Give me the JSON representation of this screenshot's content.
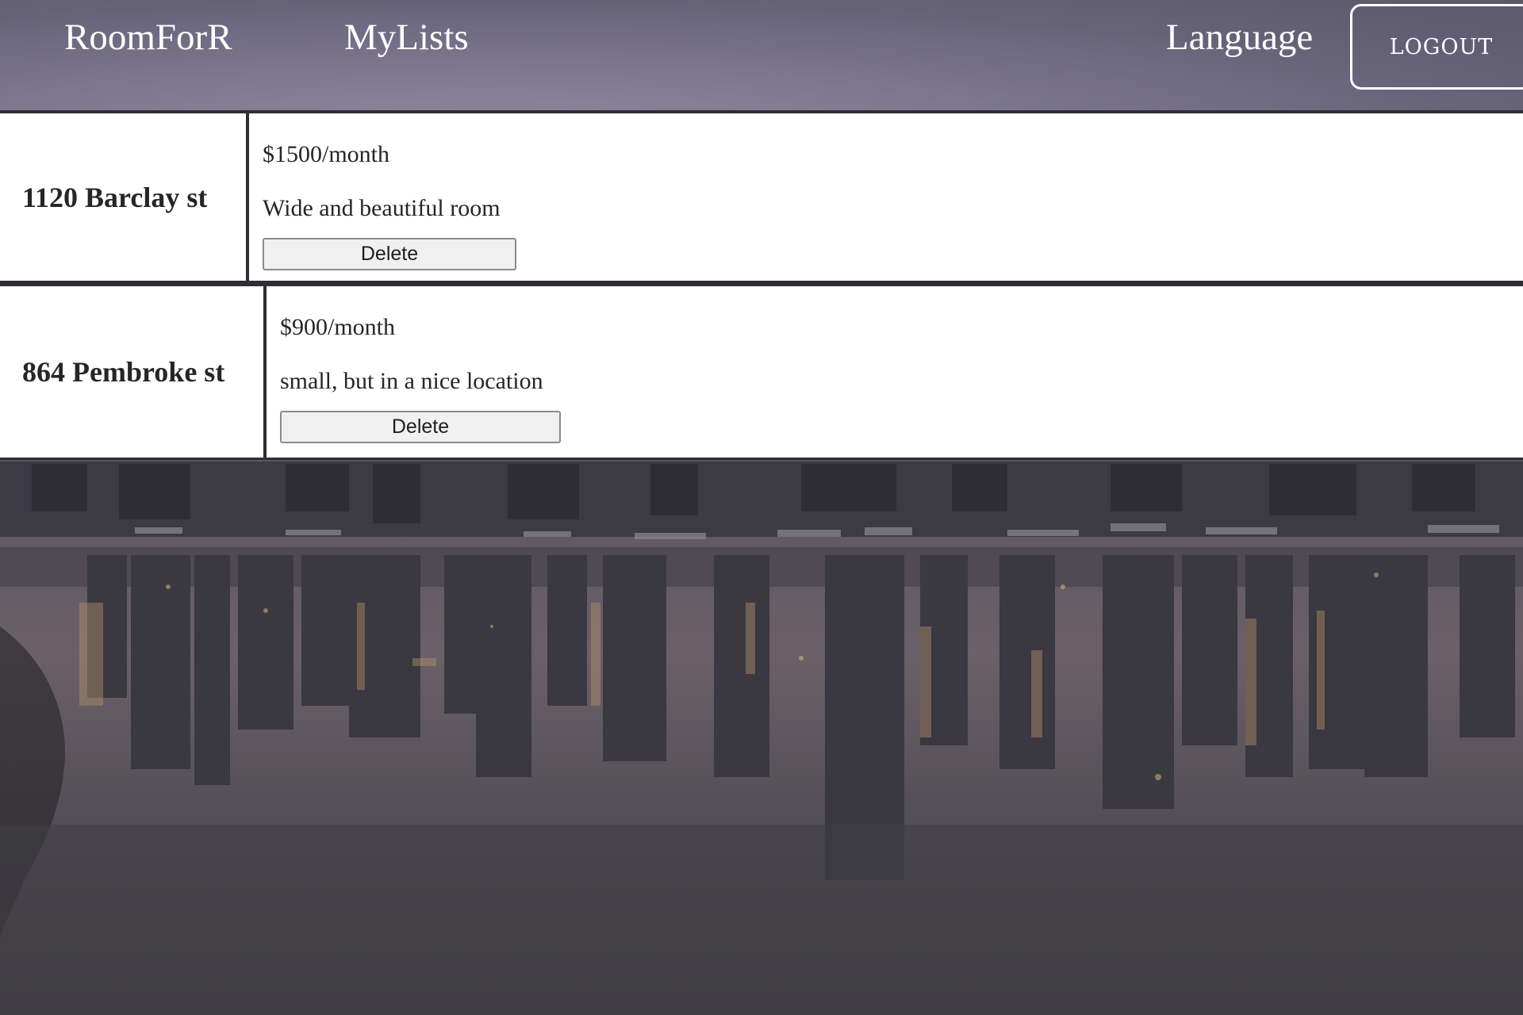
{
  "header": {
    "brand": "RoomForR",
    "nav_mylists": "MyLists",
    "nav_language": "Language",
    "logout_label": "LOGOUT"
  },
  "listings": [
    {
      "address": "1120 Barclay st",
      "price": "$1500/month",
      "description": "Wide and beautiful room",
      "delete_label": "Delete"
    },
    {
      "address": "864 Pembroke st",
      "price": "$900/month",
      "description": "small, but in a nice location",
      "delete_label": "Delete"
    }
  ],
  "colors": {
    "header_bg": "#7d7790",
    "divider": "#2f2f33",
    "text_dark": "#262626",
    "button_bg": "#f0f0f0"
  }
}
